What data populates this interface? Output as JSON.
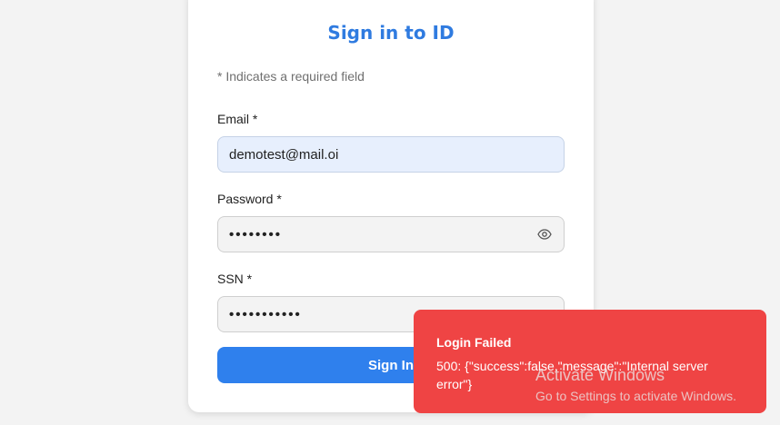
{
  "login": {
    "title": "Sign in to ID",
    "required_note": "* Indicates a required field",
    "email": {
      "label": "Email *",
      "value": "demotest@mail.oi"
    },
    "password": {
      "label": "Password *",
      "masked_value": "••••••••"
    },
    "ssn": {
      "label": "SSN *",
      "masked_value": "•••••••••••"
    },
    "submit_label": "Sign In"
  },
  "toast": {
    "title": "Login Failed",
    "message": "500: {\"success\":false,\"message\":\"Internal server error\"}",
    "color": "#ef4444"
  },
  "watermark": {
    "title": "Activate Windows",
    "subtitle": "Go to Settings to activate Windows."
  },
  "colors": {
    "accent": "#2f80ed",
    "title": "#2f7be0",
    "page_bg": "#f3f3f3"
  },
  "icons": {
    "password_toggle": "eye-icon"
  }
}
